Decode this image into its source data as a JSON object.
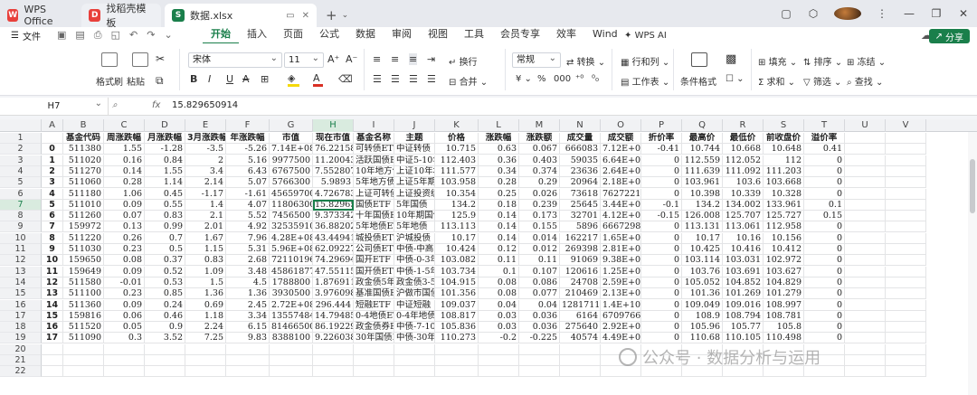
{
  "titlebar": {
    "app_tab": "WPS Office",
    "template_tab": "找稻壳模板",
    "file_tab": "数据.xlsx"
  },
  "menubar": {
    "file_label": "文件",
    "menus": [
      "开始",
      "插入",
      "页面",
      "公式",
      "数据",
      "审阅",
      "视图",
      "工具",
      "会员专享",
      "效率",
      "Wind"
    ],
    "active_menu": "开始",
    "wps_ai": "WPS AI",
    "share": "分享"
  },
  "ribbon": {
    "format_painter": "格式刷",
    "paste": "粘贴",
    "font_name": "宋体",
    "font_size": "11",
    "wrap": "换行",
    "merge": "合并",
    "number_format": "常规",
    "convert": "转换",
    "rows_cols": "行和列",
    "worksheet": "工作表",
    "cond_format": "条件格式",
    "fill": "填充",
    "sort": "排序",
    "freeze": "冻结",
    "sum": "求和",
    "filter": "筛选",
    "find": "查找",
    "colors": {
      "accent": "#1a7f4b",
      "font_color": "#d93025",
      "highlight": "#f5d90a"
    }
  },
  "formula_bar": {
    "cell_ref": "H7",
    "fx": "fx",
    "value": "15.829650914"
  },
  "grid": {
    "columns": [
      "A",
      "B",
      "C",
      "D",
      "E",
      "F",
      "G",
      "H",
      "I",
      "J",
      "K",
      "L",
      "M",
      "N",
      "O",
      "P",
      "Q",
      "R",
      "S",
      "T",
      "U",
      "V"
    ],
    "selected_column": "H",
    "rows": [
      "1",
      "2",
      "3",
      "4",
      "5",
      "6",
      "7",
      "8",
      "9",
      "10",
      "11",
      "12",
      "13",
      "14",
      "15",
      "16",
      "17",
      "18",
      "19",
      "20",
      "21",
      "22"
    ],
    "selected_row": "7",
    "header": [
      "",
      "基金代码",
      "周涨跌幅",
      "月涨跌幅",
      "3月涨跌幅",
      "年涨跌幅",
      "市值",
      "现在市值",
      "基金名称",
      "主题",
      "价格",
      "涨跌幅",
      "涨跌额",
      "成交量",
      "成交额",
      "折价率",
      "最高价",
      "最低价",
      "前收盘价",
      "溢价率"
    ],
    "data": [
      [
        "0",
        "511380",
        "1.55",
        "-1.28",
        "-3.5",
        "-5.26",
        "7.14E+08",
        "76.22158",
        "可转债ETF",
        "中证转债",
        "10.715",
        "0.63",
        "0.067",
        "666083",
        "7.12E+08",
        "-0.41",
        "10.744",
        "10.668",
        "10.648",
        "0.41"
      ],
      [
        "1",
        "511020",
        "0.16",
        "0.84",
        "2",
        "5.16",
        "9977500",
        "11.20043",
        "活跃国债ETF",
        "中证5-10年",
        "112.403",
        "0.36",
        "0.403",
        "59035",
        "6.64E+08",
        "0",
        "112.559",
        "112.052",
        "112",
        "0"
      ],
      [
        "2",
        "511270",
        "0.14",
        "1.55",
        "3.4",
        "6.43",
        "6767500",
        "7.552807",
        "10年地方债",
        "上证10年地",
        "111.577",
        "0.34",
        "0.374",
        "23636",
        "2.64E+08",
        "0",
        "111.639",
        "111.092",
        "111.203",
        "0"
      ],
      [
        "3",
        "511060",
        "0.28",
        "1.14",
        "2.14",
        "5.07",
        "5766300",
        "5.9893",
        "5年地方债",
        "上证5年期",
        "103.958",
        "0.28",
        "0.29",
        "20964",
        "2.18E+08",
        "0",
        "103.961",
        "103.6",
        "103.668",
        "0"
      ],
      [
        "4",
        "511180",
        "1.06",
        "0.45",
        "-1.17",
        "-1.61",
        "45659700",
        "4.726783",
        "上证可转债",
        "上证投资级",
        "10.354",
        "0.25",
        "0.026",
        "73618",
        "76272213",
        "0",
        "10.398",
        "10.339",
        "10.328",
        "0"
      ],
      [
        "5",
        "511010",
        "0.09",
        "0.55",
        "1.4",
        "4.07",
        "11806300",
        "15.82965",
        "国债ETF",
        "5年国债",
        "134.2",
        "0.18",
        "0.239",
        "25645",
        "3.44E+08",
        "-0.1",
        "134.2",
        "134.002",
        "133.961",
        "0.1"
      ],
      [
        "6",
        "511260",
        "0.07",
        "0.83",
        "2.1",
        "5.52",
        "7456500",
        "9.373342",
        "十年国债ETF",
        "10年期国债",
        "125.9",
        "0.14",
        "0.173",
        "32701",
        "4.12E+08",
        "-0.15",
        "126.008",
        "125.707",
        "125.727",
        "0.15"
      ],
      [
        "7",
        "159972",
        "0.13",
        "0.99",
        "2.01",
        "4.92",
        "32535910",
        "36.88202",
        "5年地债ETF",
        "5年地债",
        "113.113",
        "0.14",
        "0.155",
        "5896",
        "66672989",
        "0",
        "113.131",
        "113.061",
        "112.958",
        "0"
      ],
      [
        "8",
        "511220",
        "0.26",
        "0.7",
        "1.67",
        "7.96",
        "4.28E+08",
        "43.44941",
        "城投债ETF",
        "沪城投债",
        "10.17",
        "0.14",
        "0.014",
        "162217",
        "1.65E+08",
        "0",
        "10.17",
        "10.16",
        "10.156",
        "0"
      ],
      [
        "9",
        "511030",
        "0.23",
        "0.5",
        "1.15",
        "5.31",
        "5.96E+08",
        "62.09227",
        "公司债ETF",
        "中债-中高",
        "10.424",
        "0.12",
        "0.012",
        "269398",
        "2.81E+08",
        "0",
        "10.425",
        "10.416",
        "10.412",
        "0"
      ],
      [
        "10",
        "159650",
        "0.08",
        "0.37",
        "0.83",
        "2.68",
        "72110196",
        "74.29694",
        "国开ETF",
        "中债-0-3年",
        "103.082",
        "0.11",
        "0.11",
        "91069",
        "9.38E+08",
        "0",
        "103.114",
        "103.031",
        "102.972",
        "0"
      ],
      [
        "11",
        "159649",
        "0.09",
        "0.52",
        "1.09",
        "3.48",
        "45861877",
        "47.55115",
        "国开债ETF",
        "中债-1-5年",
        "103.734",
        "0.1",
        "0.107",
        "120616",
        "1.25E+09",
        "0",
        "103.76",
        "103.691",
        "103.627",
        "0"
      ],
      [
        "12",
        "511580",
        "-0.01",
        "0.53",
        "1.5",
        "4.5",
        "1788800",
        "1.876911",
        "政金债5年",
        "政金债3-5年",
        "104.915",
        "0.08",
        "0.086",
        "24708",
        "2.59E+08",
        "0",
        "105.052",
        "104.852",
        "104.829",
        "0"
      ],
      [
        "13",
        "511100",
        "0.23",
        "0.85",
        "1.36",
        "1.36",
        "3930500",
        "3.976098",
        "基准国债ETF",
        "沪做市国债",
        "101.356",
        "0.08",
        "0.077",
        "210469",
        "2.13E+09",
        "0",
        "101.36",
        "101.269",
        "101.279",
        "0"
      ],
      [
        "14",
        "511360",
        "0.09",
        "0.24",
        "0.69",
        "2.45",
        "2.72E+08",
        "296.444",
        "短融ETF",
        "中证短融",
        "109.037",
        "0.04",
        "0.04",
        "1281711",
        "1.4E+10",
        "0",
        "109.049",
        "109.016",
        "108.997",
        "0"
      ],
      [
        "15",
        "159816",
        "0.06",
        "0.46",
        "1.18",
        "3.34",
        "13557484",
        "14.79485",
        "0-4地债ETF",
        "0-4年地债",
        "108.817",
        "0.03",
        "0.036",
        "6164",
        "67097660",
        "0",
        "108.9",
        "108.794",
        "108.781",
        "0"
      ],
      [
        "16",
        "511520",
        "0.05",
        "0.9",
        "2.24",
        "6.15",
        "81466500",
        "86.19229",
        "政金债券ETF",
        "中债-7-10年",
        "105.836",
        "0.03",
        "0.036",
        "275640",
        "2.92E+09",
        "0",
        "105.96",
        "105.77",
        "105.8",
        "0"
      ],
      [
        "17",
        "511090",
        "0.3",
        "3.52",
        "7.25",
        "9.83",
        "8388100",
        "9.226038",
        "30年国债ETF",
        "中债-30年",
        "110.273",
        "-0.2",
        "-0.225",
        "40574",
        "4.49E+08",
        "0",
        "110.68",
        "110.105",
        "110.498",
        "0"
      ]
    ]
  },
  "watermark": "公众号 · 数据分析与运用"
}
